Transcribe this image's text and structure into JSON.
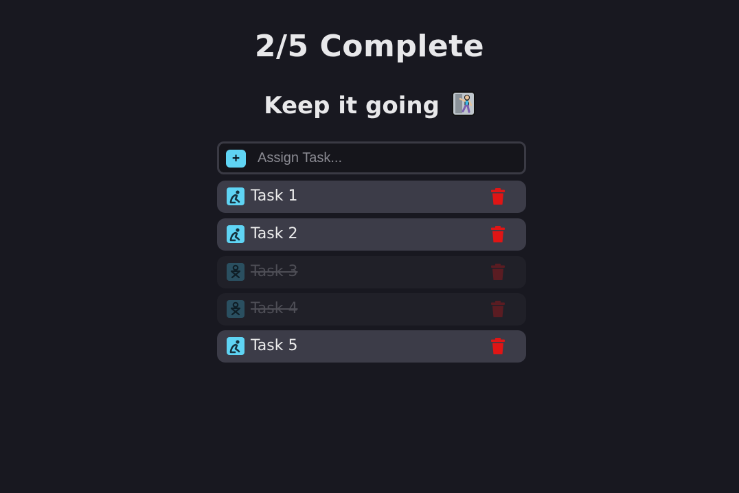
{
  "header": {
    "progress_title": "2/5 Complete",
    "subtitle": "Keep it going"
  },
  "input": {
    "add_label": "+",
    "placeholder": "Assign Task..."
  },
  "tasks": [
    {
      "label": "Task 1",
      "done": false
    },
    {
      "label": "Task 2",
      "done": false
    },
    {
      "label": "Task 3",
      "done": true
    },
    {
      "label": "Task 4",
      "done": true
    },
    {
      "label": "Task 5",
      "done": false
    }
  ],
  "colors": {
    "background": "#181820",
    "accent": "#5fd4f4",
    "delete": "#e01515",
    "task_bg": "#3c3c48",
    "task_done_bg": "#202028"
  }
}
